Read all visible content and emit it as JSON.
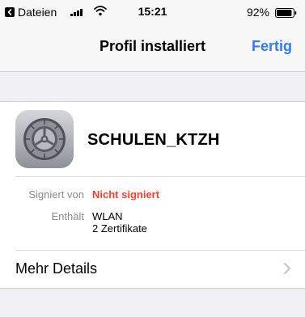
{
  "status_bar": {
    "back_app_label": "Dateien",
    "time": "15:21",
    "battery_percent": "92%",
    "battery_level": 0.92,
    "signal_icon": "cellular-signal-icon",
    "wifi_icon": "wifi-icon"
  },
  "nav": {
    "title": "Profil installiert",
    "done_label": "Fertig",
    "accent_color": "#2f7bf6"
  },
  "profile": {
    "name": "SCHULEN_KTZH",
    "icon": "settings-gear-icon"
  },
  "details": {
    "signed_by_key": "Signiert von",
    "signed_by_value": "Nicht signiert",
    "signed_by_color": "#ff3b30",
    "contains_key": "Enthält",
    "contains_values": [
      "WLAN",
      "2 Zertifikate"
    ]
  },
  "more_details": {
    "label": "Mehr Details",
    "icon": "chevron-right-icon"
  }
}
